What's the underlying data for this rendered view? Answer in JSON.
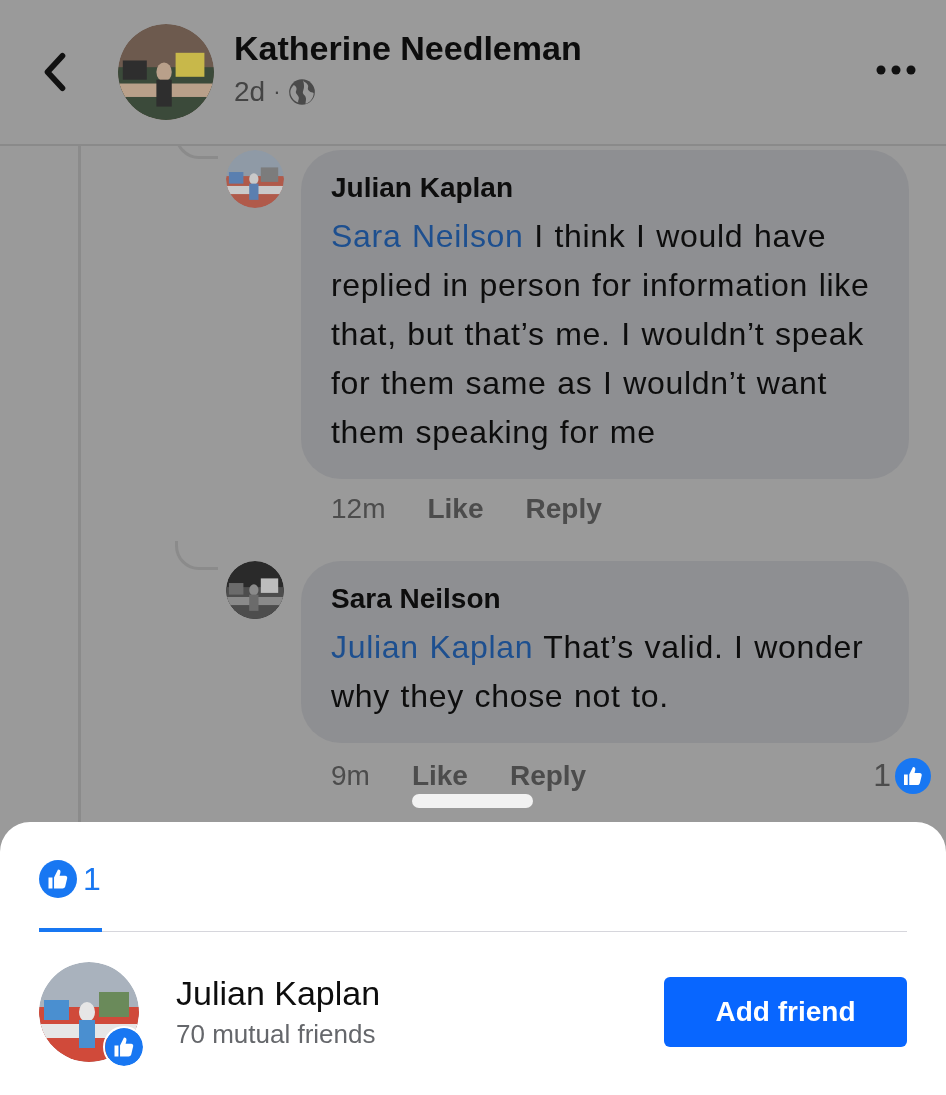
{
  "header": {
    "author": "Katherine Needleman",
    "time": "2d",
    "separator": "·"
  },
  "comments": [
    {
      "author": "Julian Kaplan",
      "mention": "Sara Neilson",
      "text": "I think I would have replied in person for information like that, but that’s me. I wouldn’t speak for them same as I wouldn’t want them speaking for me",
      "time": "12m",
      "actions": [
        "Like",
        "Reply"
      ]
    },
    {
      "author": "Sara Neilson",
      "mention": "Julian Kaplan",
      "text": "That’s valid. I wonder why they chose not to.",
      "time": "9m",
      "actions": [
        "Like",
        "Reply"
      ],
      "reaction_count": "1"
    }
  ],
  "reactions_sheet": {
    "tabs": [
      {
        "count": "1",
        "selected": true
      }
    ],
    "people": [
      {
        "name": "Julian Kaplan",
        "subtitle": "70 mutual friends",
        "button": "Add friend"
      }
    ]
  }
}
